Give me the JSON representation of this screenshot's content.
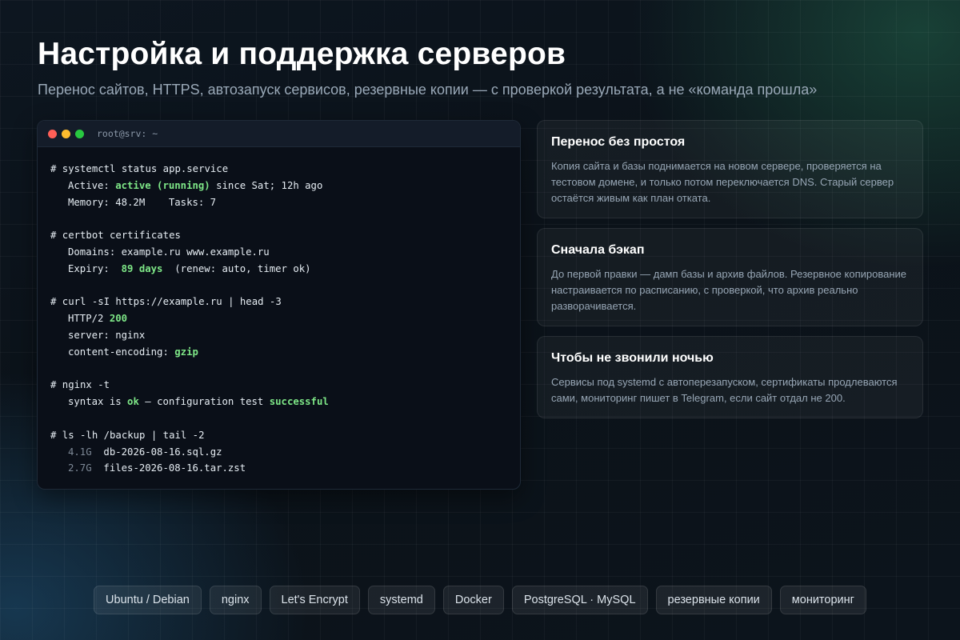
{
  "header": {
    "title": "Настройка и поддержка серверов",
    "subtitle": "Перенос сайтов, HTTPS, автозапуск сервисов, резервные копии — с проверкой результата, а не «команда прошла»"
  },
  "terminal": {
    "title": "root@srv: ~",
    "colors": {
      "red": "#ff5f57",
      "yellow": "#febc2e",
      "green": "#28c840",
      "highlight": "#7ee787"
    },
    "lines": [
      {
        "indent": false,
        "parts": [
          {
            "t": "# systemctl status app.service"
          }
        ]
      },
      {
        "indent": true,
        "parts": [
          {
            "t": "Active: "
          },
          {
            "t": "active (running)",
            "c": "hl"
          },
          {
            "t": " since Sat; 12h ago"
          }
        ]
      },
      {
        "indent": true,
        "parts": [
          {
            "t": "Memory: 48.2M    Tasks: 7"
          }
        ]
      },
      {
        "indent": false,
        "parts": []
      },
      {
        "indent": false,
        "parts": [
          {
            "t": "# certbot certificates"
          }
        ]
      },
      {
        "indent": true,
        "parts": [
          {
            "t": "Domains: example.ru www.example.ru"
          }
        ]
      },
      {
        "indent": true,
        "parts": [
          {
            "t": "Expiry:  "
          },
          {
            "t": "89 days",
            "c": "hl"
          },
          {
            "t": "  (renew: auto, timer ok)"
          }
        ]
      },
      {
        "indent": false,
        "parts": []
      },
      {
        "indent": false,
        "parts": [
          {
            "t": "# curl -sI https://example.ru | head -3"
          }
        ]
      },
      {
        "indent": true,
        "parts": [
          {
            "t": "HTTP/2 "
          },
          {
            "t": "200",
            "c": "hl"
          }
        ]
      },
      {
        "indent": true,
        "parts": [
          {
            "t": "server: nginx"
          }
        ]
      },
      {
        "indent": true,
        "parts": [
          {
            "t": "content-encoding: "
          },
          {
            "t": "gzip",
            "c": "hl"
          }
        ]
      },
      {
        "indent": false,
        "parts": []
      },
      {
        "indent": false,
        "parts": [
          {
            "t": "# nginx -t"
          }
        ]
      },
      {
        "indent": true,
        "parts": [
          {
            "t": "syntax is "
          },
          {
            "t": "ok",
            "c": "hl"
          },
          {
            "t": " — configuration test "
          },
          {
            "t": "successful",
            "c": "hl"
          }
        ]
      },
      {
        "indent": false,
        "parts": []
      },
      {
        "indent": false,
        "parts": [
          {
            "t": "# ls -lh /backup | tail -2"
          }
        ]
      },
      {
        "indent": true,
        "parts": [
          {
            "t": "4.1G",
            "c": "dim"
          },
          {
            "t": "  db-2026-08-16.sql.gz"
          }
        ]
      },
      {
        "indent": true,
        "parts": [
          {
            "t": "2.7G",
            "c": "dim"
          },
          {
            "t": "  files-2026-08-16.tar.zst"
          }
        ]
      }
    ]
  },
  "cards": [
    {
      "title": "Перенос без простоя",
      "text": "Копия сайта и базы поднимается на новом сервере, проверяется на тестовом домене, и только потом переключается DNS. Старый сервер остаётся живым как план отката."
    },
    {
      "title": "Сначала бэкап",
      "text": "До первой правки — дамп базы и архив файлов. Резервное копирование настраивается по расписанию, с проверкой, что архив реально разворачивается."
    },
    {
      "title": "Чтобы не звонили ночью",
      "text": "Сервисы под systemd с автоперезапуском, сертификаты продлеваются сами, мониторинг пишет в Telegram, если сайт отдал не 200."
    }
  ],
  "tags": [
    "Ubuntu / Debian",
    "nginx",
    "Let's Encrypt",
    "systemd",
    "Docker",
    "PostgreSQL · MySQL",
    "резервные копии",
    "мониторинг"
  ]
}
